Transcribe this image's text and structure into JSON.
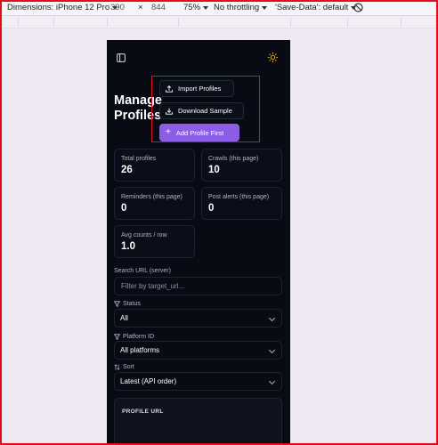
{
  "devtools": {
    "dimensions_label": "Dimensions: iPhone 12 Pro",
    "width": "390",
    "height": "844",
    "zoom": "75%",
    "throttling": "No throttling",
    "save_data": "'Save-Data': default"
  },
  "page": {
    "title": "Manage Profiles"
  },
  "actions": {
    "import_label": "Import Profiles",
    "download_label": "Download Sample",
    "add_label": "Add Profile First"
  },
  "stats": [
    {
      "label": "Total profiles",
      "value": "26"
    },
    {
      "label": "Crawls (this page)",
      "value": "10"
    },
    {
      "label": "Reminders (this page)",
      "value": "0"
    },
    {
      "label": "Post alerts (this page)",
      "value": "0"
    },
    {
      "label": "Avg counts / row",
      "value": "1.0"
    }
  ],
  "filters": {
    "search_label": "Search URL (server)",
    "search_placeholder": "Filter by target_url...",
    "status_label": "Status",
    "status_value": "All",
    "platform_label": "Platform ID",
    "platform_value": "All platforms",
    "sort_label": "Sort",
    "sort_value": "Latest (API order)"
  },
  "table": {
    "column_profile_url": "PROFILE URL"
  },
  "colors": {
    "background": "#080b14",
    "accent": "#8d5de6",
    "highlight": "#e0101a"
  }
}
